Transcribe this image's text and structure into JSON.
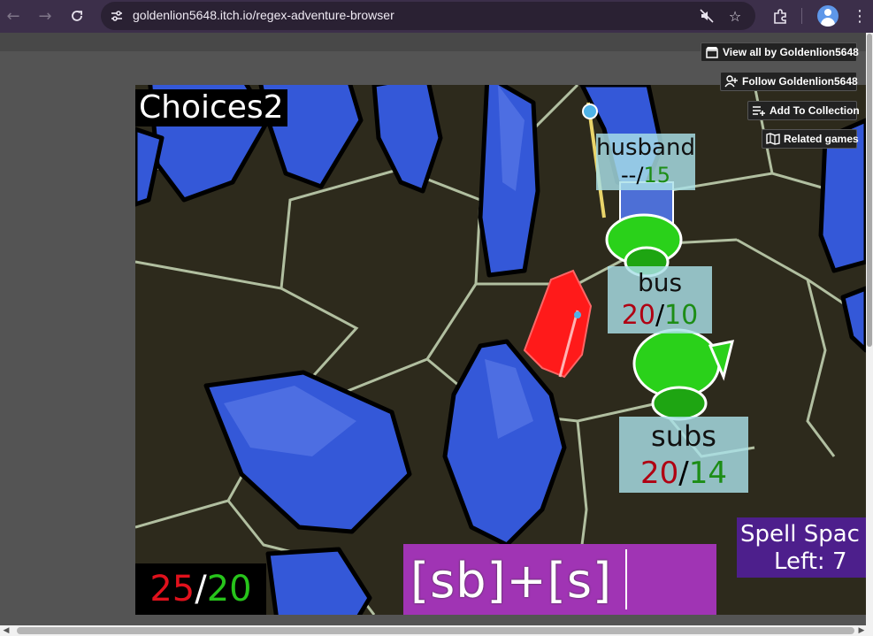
{
  "browser": {
    "url": "goldenlion5648.itch.io/regex-adventure-browser",
    "icons": [
      "back-arrow-icon",
      "forward-arrow-icon",
      "reload-icon",
      "site-info-icon",
      "mute-icon",
      "bookmark-star-icon",
      "extensions-icon",
      "profile-icon",
      "more-menu-icon"
    ]
  },
  "itch_buttons": {
    "view_all": "View all by Goldenlion5648",
    "follow": "Follow Goldenlion5648",
    "add_collection": "Add To Collection",
    "related": "Related games"
  },
  "game": {
    "level_title": "Choices2",
    "enemies": [
      {
        "name": "husband",
        "current": "--",
        "max": "15"
      },
      {
        "name": "bus",
        "current": "20",
        "max": "10"
      },
      {
        "name": "subs",
        "current": "20",
        "max": "14"
      }
    ],
    "player_hp": {
      "current": "25",
      "max": "20"
    },
    "spell_input": "[sb]+[s]",
    "spell_space_line1": "Spell Spac",
    "spell_space_line2": "Left: 7",
    "slash": "/"
  },
  "colors": {
    "chrome": "#3c2f4a",
    "spell_box": "#a034b4",
    "spell_left_box": "#4d1f8c",
    "hp_current": "#e0111c",
    "hp_max": "#27c41b",
    "crystal": "#3a5ad6",
    "goblin": "#2ad11a"
  }
}
